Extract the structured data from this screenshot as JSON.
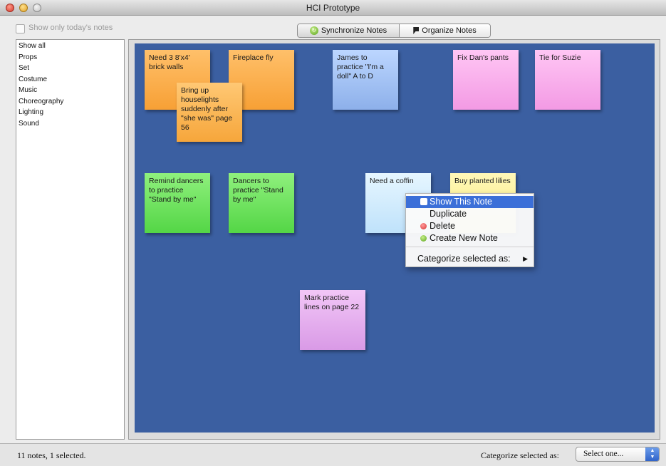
{
  "window": {
    "title": "HCI Prototype"
  },
  "filter": {
    "show_today_label": "Show only today's notes",
    "show_today_checked": false
  },
  "toolbar": {
    "sync_label": "Synchronize Notes",
    "organize_label": "Organize Notes",
    "sync_icon": "sync-icon",
    "organize_icon": "note-icon"
  },
  "sidebar": {
    "items": [
      {
        "label": "Show all"
      },
      {
        "label": "Props"
      },
      {
        "label": "Set"
      },
      {
        "label": "Costume"
      },
      {
        "label": "Music"
      },
      {
        "label": "Choreography"
      },
      {
        "label": "Lighting"
      },
      {
        "label": "Sound"
      }
    ]
  },
  "board": {
    "background": "#3b5fa1",
    "notes": [
      {
        "text": "Need 3 8'x4' brick walls",
        "color": "orange"
      },
      {
        "text": "Fireplace fly",
        "color": "orange"
      },
      {
        "text": "Bring up houselights suddenly after \"she was\" page 56",
        "color": "orange"
      },
      {
        "text": "James to practice \"I'm a doll\" A to D",
        "color": "blue"
      },
      {
        "text": "Fix Dan's pants",
        "color": "pink"
      },
      {
        "text": "Tie for Suzie",
        "color": "pink"
      },
      {
        "text": "Remind dancers to practice \"Stand by me\"",
        "color": "green"
      },
      {
        "text": "Dancers to practice \"Stand by me\"",
        "color": "green"
      },
      {
        "text": "Need a coffin",
        "color": "light-blue"
      },
      {
        "text": "Buy planted lilies",
        "color": "yellow"
      },
      {
        "text": "Mark practice lines on page 22",
        "color": "purple"
      }
    ]
  },
  "context_menu": {
    "show_note": "Show This Note",
    "duplicate": "Duplicate",
    "delete": "Delete",
    "create_new": "Create New Note",
    "categorize": "Categorize selected as:",
    "highlight_color": "#3b6fd8"
  },
  "status": {
    "summary": "11 notes, 1 selected.",
    "categorize_label": "Categorize selected as:",
    "select_value": "Select one..."
  }
}
